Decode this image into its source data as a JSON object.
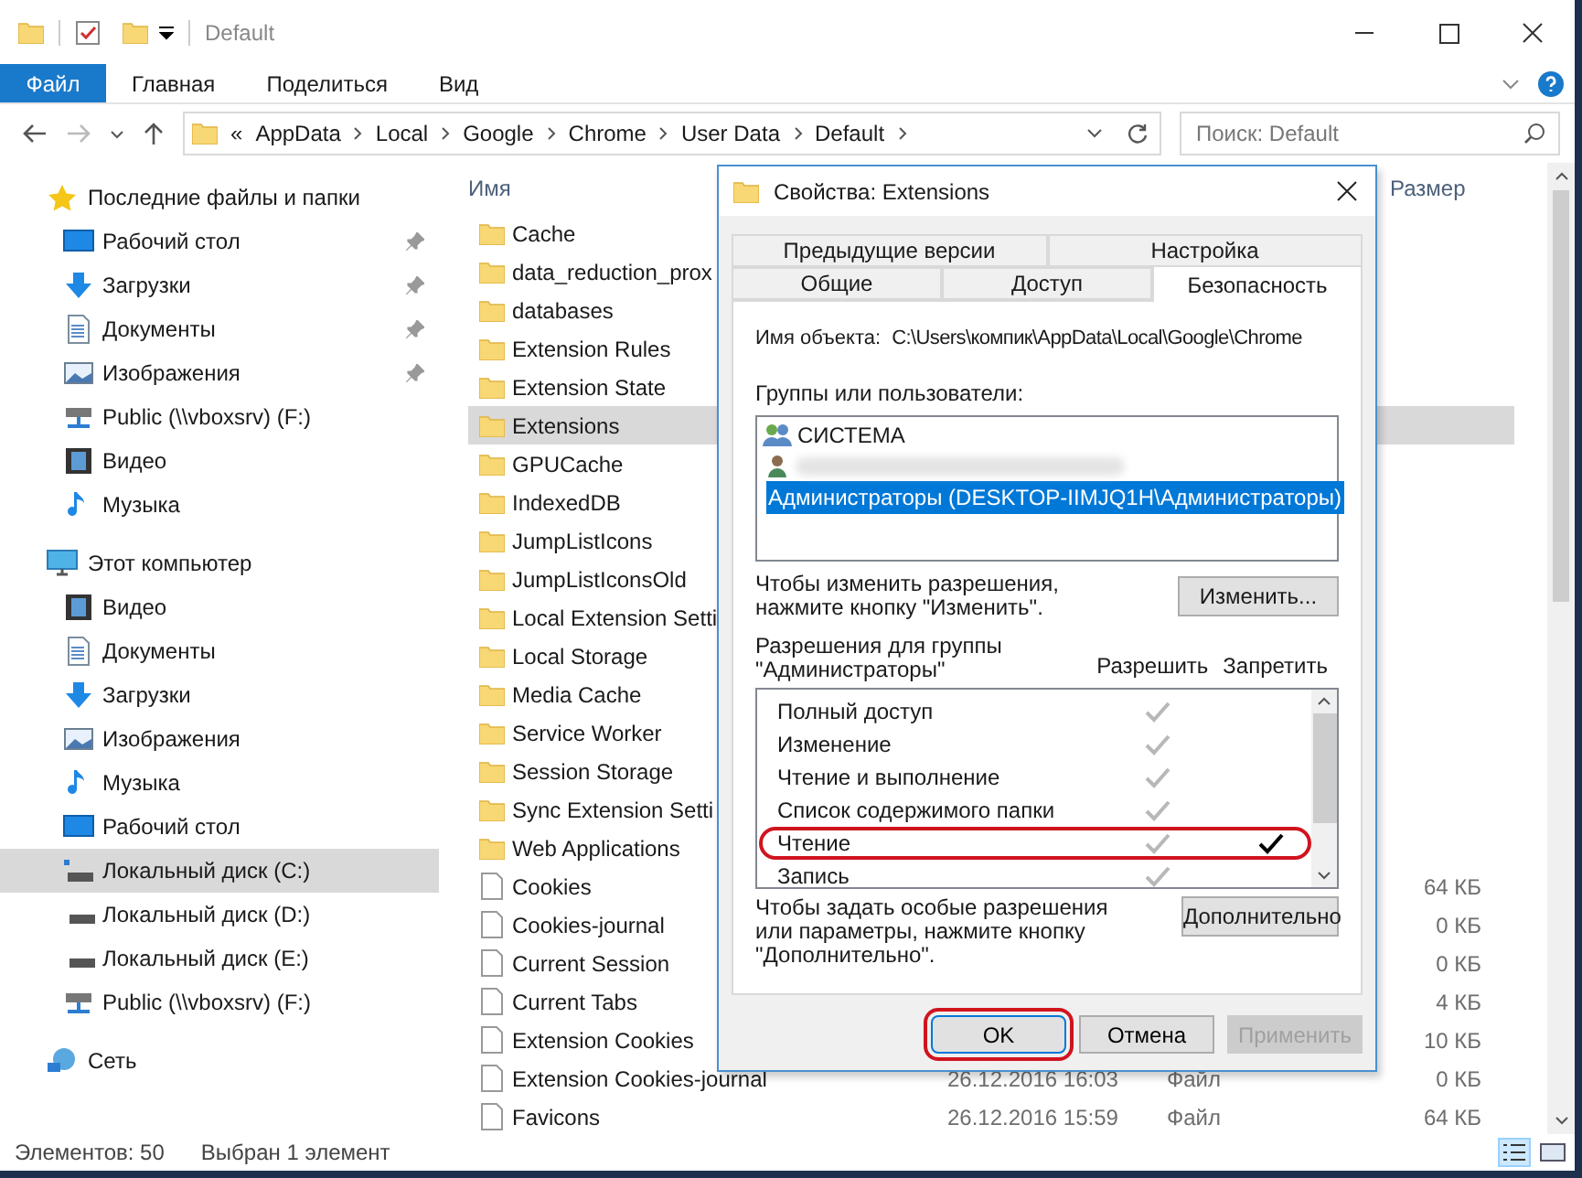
{
  "window": {
    "title": "Default"
  },
  "ribbon": {
    "tabs": [
      {
        "label": "Файл",
        "selected": true
      },
      {
        "label": "Главная",
        "selected": false
      },
      {
        "label": "Поделиться",
        "selected": false
      },
      {
        "label": "Вид",
        "selected": false
      }
    ]
  },
  "address_bar": {
    "overflow": "«",
    "segments": [
      "AppData",
      "Local",
      "Google",
      "Chrome",
      "User Data",
      "Default"
    ]
  },
  "search": {
    "placeholder": "Поиск: Default"
  },
  "sidebar": {
    "groups": [
      {
        "label": "Последние файлы и папки",
        "kind": "quick-access",
        "selected": false,
        "children": [
          {
            "label": "Рабочий стол",
            "kind": "desktop",
            "pinned": true,
            "selected": false
          },
          {
            "label": "Загрузки",
            "kind": "downloads",
            "pinned": true,
            "selected": false
          },
          {
            "label": "Документы",
            "kind": "documents",
            "pinned": true,
            "selected": false
          },
          {
            "label": "Изображения",
            "kind": "pictures",
            "pinned": true,
            "selected": false
          },
          {
            "label": "Public (\\\\vboxsrv) (F:)",
            "kind": "network-drive",
            "pinned": false,
            "selected": false
          },
          {
            "label": "Видео",
            "kind": "videos",
            "pinned": false,
            "selected": false
          },
          {
            "label": "Музыка",
            "kind": "music",
            "pinned": false,
            "selected": false
          }
        ]
      },
      {
        "label": "Этот компьютер",
        "kind": "computer",
        "selected": false,
        "children": [
          {
            "label": "Видео",
            "kind": "videos",
            "pinned": false,
            "selected": false
          },
          {
            "label": "Документы",
            "kind": "documents",
            "pinned": false,
            "selected": false
          },
          {
            "label": "Загрузки",
            "kind": "downloads",
            "pinned": false,
            "selected": false
          },
          {
            "label": "Изображения",
            "kind": "pictures",
            "pinned": false,
            "selected": false
          },
          {
            "label": "Музыка",
            "kind": "music",
            "pinned": false,
            "selected": false
          },
          {
            "label": "Рабочий стол",
            "kind": "desktop",
            "pinned": false,
            "selected": false
          },
          {
            "label": "Локальный диск (C:)",
            "kind": "system-disk",
            "pinned": false,
            "selected": true
          },
          {
            "label": "Локальный диск (D:)",
            "kind": "local-disk",
            "pinned": false,
            "selected": false
          },
          {
            "label": "Локальный диск (E:)",
            "kind": "local-disk",
            "pinned": false,
            "selected": false
          },
          {
            "label": "Public (\\\\vboxsrv) (F:)",
            "kind": "network-drive",
            "pinned": false,
            "selected": false
          }
        ]
      },
      {
        "label": "Сеть",
        "kind": "network",
        "selected": false
      }
    ]
  },
  "file_list": {
    "columns": [
      "Имя",
      "Размер"
    ],
    "rows": [
      {
        "name": "Cache",
        "kind": "folder",
        "selected": false
      },
      {
        "name": "data_reduction_prox",
        "kind": "folder",
        "selected": false
      },
      {
        "name": "databases",
        "kind": "folder",
        "selected": false
      },
      {
        "name": "Extension Rules",
        "kind": "folder",
        "selected": false
      },
      {
        "name": "Extension State",
        "kind": "folder",
        "selected": false
      },
      {
        "name": "Extensions",
        "kind": "folder",
        "selected": true
      },
      {
        "name": "GPUCache",
        "kind": "folder",
        "selected": false
      },
      {
        "name": "IndexedDB",
        "kind": "folder",
        "selected": false
      },
      {
        "name": "JumpListIcons",
        "kind": "folder",
        "selected": false
      },
      {
        "name": "JumpListIconsOld",
        "kind": "folder",
        "selected": false
      },
      {
        "name": "Local Extension Setti",
        "kind": "folder",
        "selected": false
      },
      {
        "name": "Local Storage",
        "kind": "folder",
        "selected": false
      },
      {
        "name": "Media Cache",
        "kind": "folder",
        "selected": false
      },
      {
        "name": "Service Worker",
        "kind": "folder",
        "selected": false
      },
      {
        "name": "Session Storage",
        "kind": "folder",
        "selected": false
      },
      {
        "name": "Sync Extension Setti",
        "kind": "folder",
        "selected": false
      },
      {
        "name": "Web Applications",
        "kind": "folder",
        "selected": false
      },
      {
        "name": "Cookies",
        "kind": "file",
        "selected": false,
        "size": "64 КБ"
      },
      {
        "name": "Cookies-journal",
        "kind": "file",
        "selected": false,
        "size": "0 КБ"
      },
      {
        "name": "Current Session",
        "kind": "file",
        "selected": false,
        "size": "0 КБ"
      },
      {
        "name": "Current Tabs",
        "kind": "file",
        "selected": false,
        "size": "4 КБ"
      },
      {
        "name": "Extension Cookies",
        "kind": "file",
        "selected": false,
        "size": "10 КБ"
      },
      {
        "name": "Extension Cookies-journal",
        "kind": "file",
        "selected": false,
        "date": "26.12.2016 16:03",
        "type": "Файл",
        "size": "0 КБ"
      },
      {
        "name": "Favicons",
        "kind": "file",
        "selected": false,
        "date": "26.12.2016 15:59",
        "type": "Файл",
        "size": "64 КБ"
      }
    ]
  },
  "dialog": {
    "title": "Свойства: Extensions",
    "tab_rows": [
      {
        "tabs": [
          {
            "label": "Предыдущие версии",
            "selected": false
          },
          {
            "label": "Настройка",
            "selected": false
          }
        ]
      },
      {
        "tabs": [
          {
            "label": "Общие",
            "selected": false
          },
          {
            "label": "Доступ",
            "selected": false
          },
          {
            "label": "Безопасность",
            "selected": true
          }
        ]
      }
    ],
    "object_name": {
      "label": "Имя объекта:",
      "value": "C:\\Users\\компик\\AppData\\Local\\Google\\Chrome"
    },
    "groups_label": "Группы или пользователи:",
    "users": [
      {
        "kind": "group",
        "name": "СИСТЕМА",
        "selected": false
      },
      {
        "kind": "user",
        "blurred": true,
        "selected": false
      },
      {
        "kind": "group",
        "name": "Администраторы (DESKTOP-IIMJQ1H\\Администраторы)",
        "selected": true
      }
    ],
    "change_hint": "Чтобы изменить разрешения, нажмите кнопку \"Изменить\".",
    "change_button": "Изменить...",
    "permissions_label": "Разрешения для группы \"Администраторы\"",
    "permission_columns": [
      "Разрешить",
      "Запретить"
    ],
    "permissions": [
      {
        "name": "Полный доступ",
        "allow": true,
        "inherited": true,
        "deny": false,
        "highlighted": false
      },
      {
        "name": "Изменение",
        "allow": true,
        "inherited": true,
        "deny": false,
        "highlighted": false
      },
      {
        "name": "Чтение и выполнение",
        "allow": true,
        "inherited": true,
        "deny": false,
        "highlighted": false
      },
      {
        "name": "Список содержимого папки",
        "allow": true,
        "inherited": true,
        "deny": false,
        "highlighted": false
      },
      {
        "name": "Чтение",
        "allow": true,
        "inherited": true,
        "deny": true,
        "highlighted": true
      },
      {
        "name": "Запись",
        "allow": true,
        "inherited": true,
        "deny": false,
        "highlighted": false
      }
    ],
    "advanced_hint": "Чтобы задать особые разрешения или параметры, нажмите кнопку \"Дополнительно\".",
    "advanced_button": "Дополнительно",
    "buttons": [
      {
        "label": "OK",
        "disabled": false,
        "highlighted": true
      },
      {
        "label": "Отмена",
        "disabled": false,
        "highlighted": false
      },
      {
        "label": "Применить",
        "disabled": true,
        "highlighted": false
      }
    ]
  },
  "status_bar": {
    "items": "Элементов: 50",
    "selection": "Выбран 1 элемент"
  }
}
